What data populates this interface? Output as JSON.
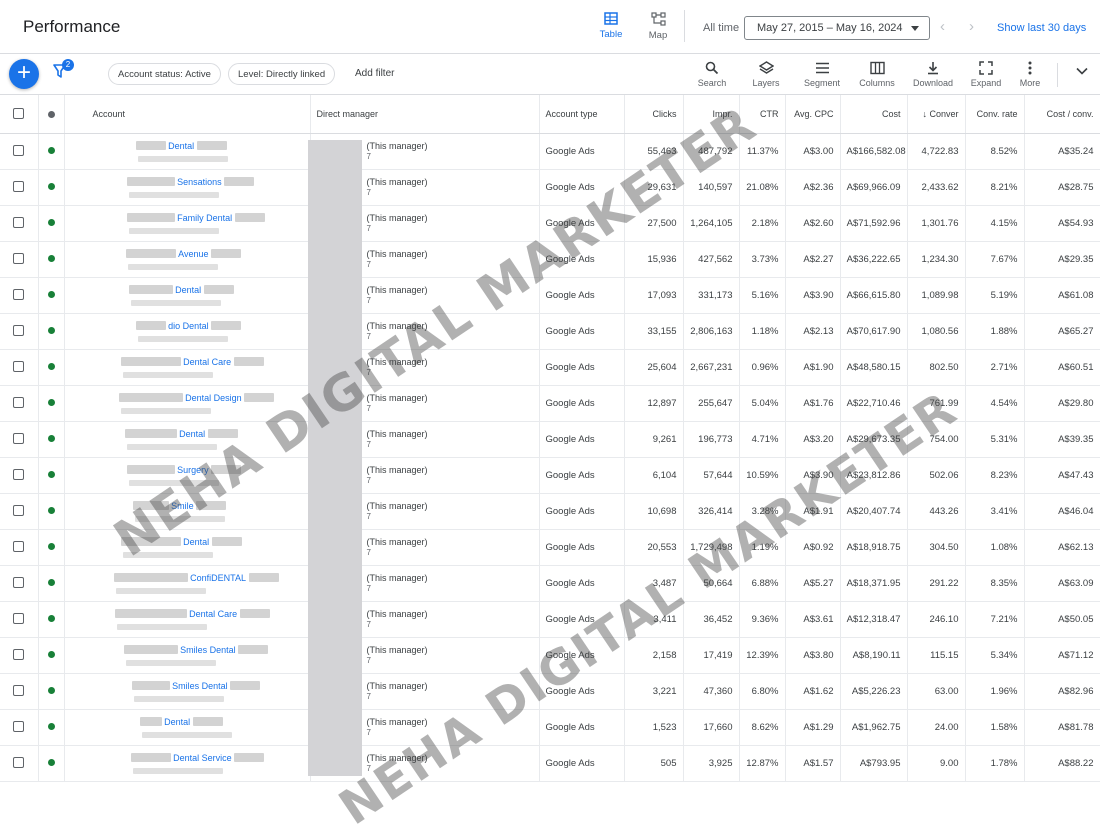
{
  "header": {
    "title": "Performance",
    "view_table": "Table",
    "view_map": "Map",
    "date_label": "All time",
    "date_range": "May 27, 2015 – May 16, 2024",
    "show_last": "Show last 30 days"
  },
  "filters": {
    "badge": "2",
    "chip_status": "Account status: Active",
    "chip_level": "Level: Directly linked",
    "add_filter": "Add filter"
  },
  "toolbar": {
    "search": "Search",
    "layers": "Layers",
    "segment": "Segment",
    "columns": "Columns",
    "download": "Download",
    "expand": "Expand",
    "more": "More"
  },
  "columns": {
    "account": "Account",
    "manager": "Direct manager",
    "type": "Account type",
    "clicks": "Clicks",
    "impr": "Impr.",
    "ctr": "CTR",
    "cpc": "Avg. CPC",
    "cost": "Cost",
    "conv": "Conver",
    "conv_rate": "Conv. rate",
    "cost_conv": "Cost / conv."
  },
  "rows": [
    {
      "name": "Dental",
      "manager": "(This manager)",
      "manager_sub": "7",
      "type": "Google Ads",
      "clicks": "55,463",
      "impr": "487,792",
      "ctr": "11.37%",
      "cpc": "A$3.00",
      "cost": "A$166,582.08",
      "conv": "4,722.83",
      "conv_rate": "8.52%",
      "cost_conv": "A$35.24"
    },
    {
      "name": "Sensations",
      "manager": "(This manager)",
      "manager_sub": "7",
      "type": "Google Ads",
      "clicks": "29,631",
      "impr": "140,597",
      "ctr": "21.08%",
      "cpc": "A$2.36",
      "cost": "A$69,966.09",
      "conv": "2,433.62",
      "conv_rate": "8.21%",
      "cost_conv": "A$28.75"
    },
    {
      "name": "Family Dental",
      "manager": "(This manager)",
      "manager_sub": "7",
      "type": "Google Ads",
      "clicks": "27,500",
      "impr": "1,264,105",
      "ctr": "2.18%",
      "cpc": "A$2.60",
      "cost": "A$71,592.96",
      "conv": "1,301.76",
      "conv_rate": "4.15%",
      "cost_conv": "A$54.93"
    },
    {
      "name": "Avenue",
      "manager": "(This manager)",
      "manager_sub": "7",
      "type": "Google Ads",
      "clicks": "15,936",
      "impr": "427,562",
      "ctr": "3.73%",
      "cpc": "A$2.27",
      "cost": "A$36,222.65",
      "conv": "1,234.30",
      "conv_rate": "7.67%",
      "cost_conv": "A$29.35"
    },
    {
      "name": "Dental",
      "manager": "(This manager)",
      "manager_sub": "7",
      "type": "Google Ads",
      "clicks": "17,093",
      "impr": "331,173",
      "ctr": "5.16%",
      "cpc": "A$3.90",
      "cost": "A$66,615.80",
      "conv": "1,089.98",
      "conv_rate": "5.19%",
      "cost_conv": "A$61.08"
    },
    {
      "name": "dio Dental",
      "manager": "(This manager)",
      "manager_sub": "7",
      "type": "Google Ads",
      "clicks": "33,155",
      "impr": "2,806,163",
      "ctr": "1.18%",
      "cpc": "A$2.13",
      "cost": "A$70,617.90",
      "conv": "1,080.56",
      "conv_rate": "1.88%",
      "cost_conv": "A$65.27"
    },
    {
      "name": "Dental Care",
      "manager": "(This manager)",
      "manager_sub": "7",
      "type": "Google Ads",
      "clicks": "25,604",
      "impr": "2,667,231",
      "ctr": "0.96%",
      "cpc": "A$1.90",
      "cost": "A$48,580.15",
      "conv": "802.50",
      "conv_rate": "2.71%",
      "cost_conv": "A$60.51"
    },
    {
      "name": "Dental Design",
      "manager": "(This manager)",
      "manager_sub": "7",
      "type": "Google Ads",
      "clicks": "12,897",
      "impr": "255,647",
      "ctr": "5.04%",
      "cpc": "A$1.76",
      "cost": "A$22,710.46",
      "conv": "761.99",
      "conv_rate": "4.54%",
      "cost_conv": "A$29.80"
    },
    {
      "name": "Dental",
      "manager": "(This manager)",
      "manager_sub": "7",
      "type": "Google Ads",
      "clicks": "9,261",
      "impr": "196,773",
      "ctr": "4.71%",
      "cpc": "A$3.20",
      "cost": "A$29,673.35",
      "conv": "754.00",
      "conv_rate": "5.31%",
      "cost_conv": "A$39.35"
    },
    {
      "name": "Surgery",
      "manager": "(This manager)",
      "manager_sub": "7",
      "type": "Google Ads",
      "clicks": "6,104",
      "impr": "57,644",
      "ctr": "10.59%",
      "cpc": "A$3.90",
      "cost": "A$23,812.86",
      "conv": "502.06",
      "conv_rate": "8.23%",
      "cost_conv": "A$47.43"
    },
    {
      "name": "Smile",
      "manager": "(This manager)",
      "manager_sub": "7",
      "type": "Google Ads",
      "clicks": "10,698",
      "impr": "326,414",
      "ctr": "3.28%",
      "cpc": "A$1.91",
      "cost": "A$20,407.74",
      "conv": "443.26",
      "conv_rate": "3.41%",
      "cost_conv": "A$46.04"
    },
    {
      "name": "Dental",
      "manager": "(This manager)",
      "manager_sub": "7",
      "type": "Google Ads",
      "clicks": "20,553",
      "impr": "1,729,498",
      "ctr": "1.19%",
      "cpc": "A$0.92",
      "cost": "A$18,918.75",
      "conv": "304.50",
      "conv_rate": "1.08%",
      "cost_conv": "A$62.13"
    },
    {
      "name": "ConfiDENTAL",
      "manager": "(This manager)",
      "manager_sub": "7",
      "type": "Google Ads",
      "clicks": "3,487",
      "impr": "50,664",
      "ctr": "6.88%",
      "cpc": "A$5.27",
      "cost": "A$18,371.95",
      "conv": "291.22",
      "conv_rate": "8.35%",
      "cost_conv": "A$63.09"
    },
    {
      "name": "Dental Care",
      "manager": "(This manager)",
      "manager_sub": "7",
      "type": "Google Ads",
      "clicks": "3,411",
      "impr": "36,452",
      "ctr": "9.36%",
      "cpc": "A$3.61",
      "cost": "A$12,318.47",
      "conv": "246.10",
      "conv_rate": "7.21%",
      "cost_conv": "A$50.05"
    },
    {
      "name": "Smiles Dental",
      "manager": "(This manager)",
      "manager_sub": "7",
      "type": "Google Ads",
      "clicks": "2,158",
      "impr": "17,419",
      "ctr": "12.39%",
      "cpc": "A$3.80",
      "cost": "A$8,190.11",
      "conv": "115.15",
      "conv_rate": "5.34%",
      "cost_conv": "A$71.12"
    },
    {
      "name": "Smiles Dental",
      "manager": "(This manager)",
      "manager_sub": "7",
      "type": "Google Ads",
      "clicks": "3,221",
      "impr": "47,360",
      "ctr": "6.80%",
      "cpc": "A$1.62",
      "cost": "A$5,226.23",
      "conv": "63.00",
      "conv_rate": "1.96%",
      "cost_conv": "A$82.96"
    },
    {
      "name": "Dental",
      "manager": "(This manager)",
      "manager_sub": "7",
      "type": "Google Ads",
      "clicks": "1,523",
      "impr": "17,660",
      "ctr": "8.62%",
      "cpc": "A$1.29",
      "cost": "A$1,962.75",
      "conv": "24.00",
      "conv_rate": "1.58%",
      "cost_conv": "A$81.78"
    },
    {
      "name": "Dental Service",
      "manager": "(This manager)",
      "manager_sub": "7",
      "type": "Google Ads",
      "clicks": "505",
      "impr": "3,925",
      "ctr": "12.87%",
      "cpc": "A$1.57",
      "cost": "A$793.95",
      "conv": "9.00",
      "conv_rate": "1.78%",
      "cost_conv": "A$88.22"
    }
  ],
  "watermark": {
    "line1": "NEHA DIGITAL MARKETER",
    "line2": "NEHA DIGITAL MARKETER"
  },
  "colors": {
    "accent": "#1a73e8",
    "status_enabled": "#188038"
  },
  "icons": {
    "table": "table-icon",
    "map": "map-icon",
    "filter": "filter-icon",
    "search": "search-icon",
    "layers": "layers-icon",
    "segment": "segment-icon",
    "columns": "columns-icon",
    "download": "download-icon",
    "expand": "expand-icon",
    "more": "more-vert-icon",
    "collapse": "chevron-down-icon",
    "sort": "arrow-down-icon"
  }
}
